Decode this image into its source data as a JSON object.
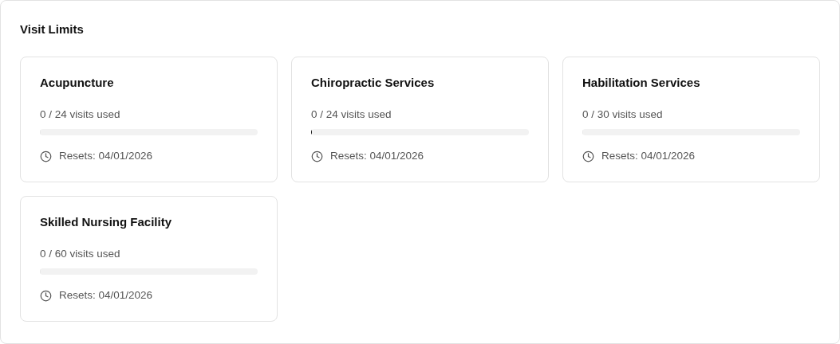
{
  "panel": {
    "title": "Visit Limits"
  },
  "limits": [
    {
      "name": "Acupuncture",
      "usage": "0 / 24 visits used",
      "level": 0,
      "reset": "Resets: 04/01/2026"
    },
    {
      "name": "Chiropractic Services",
      "usage": "0 / 24 visits used",
      "level": 0.005,
      "reset": "Resets: 04/01/2026"
    },
    {
      "name": "Habilitation Services",
      "usage": "0 / 30 visits used",
      "level": 0,
      "reset": "Resets: 04/01/2026"
    },
    {
      "name": "Skilled Nursing Facility",
      "usage": "0 / 60 visits used",
      "level": 0,
      "reset": "Resets: 04/01/2026"
    }
  ]
}
